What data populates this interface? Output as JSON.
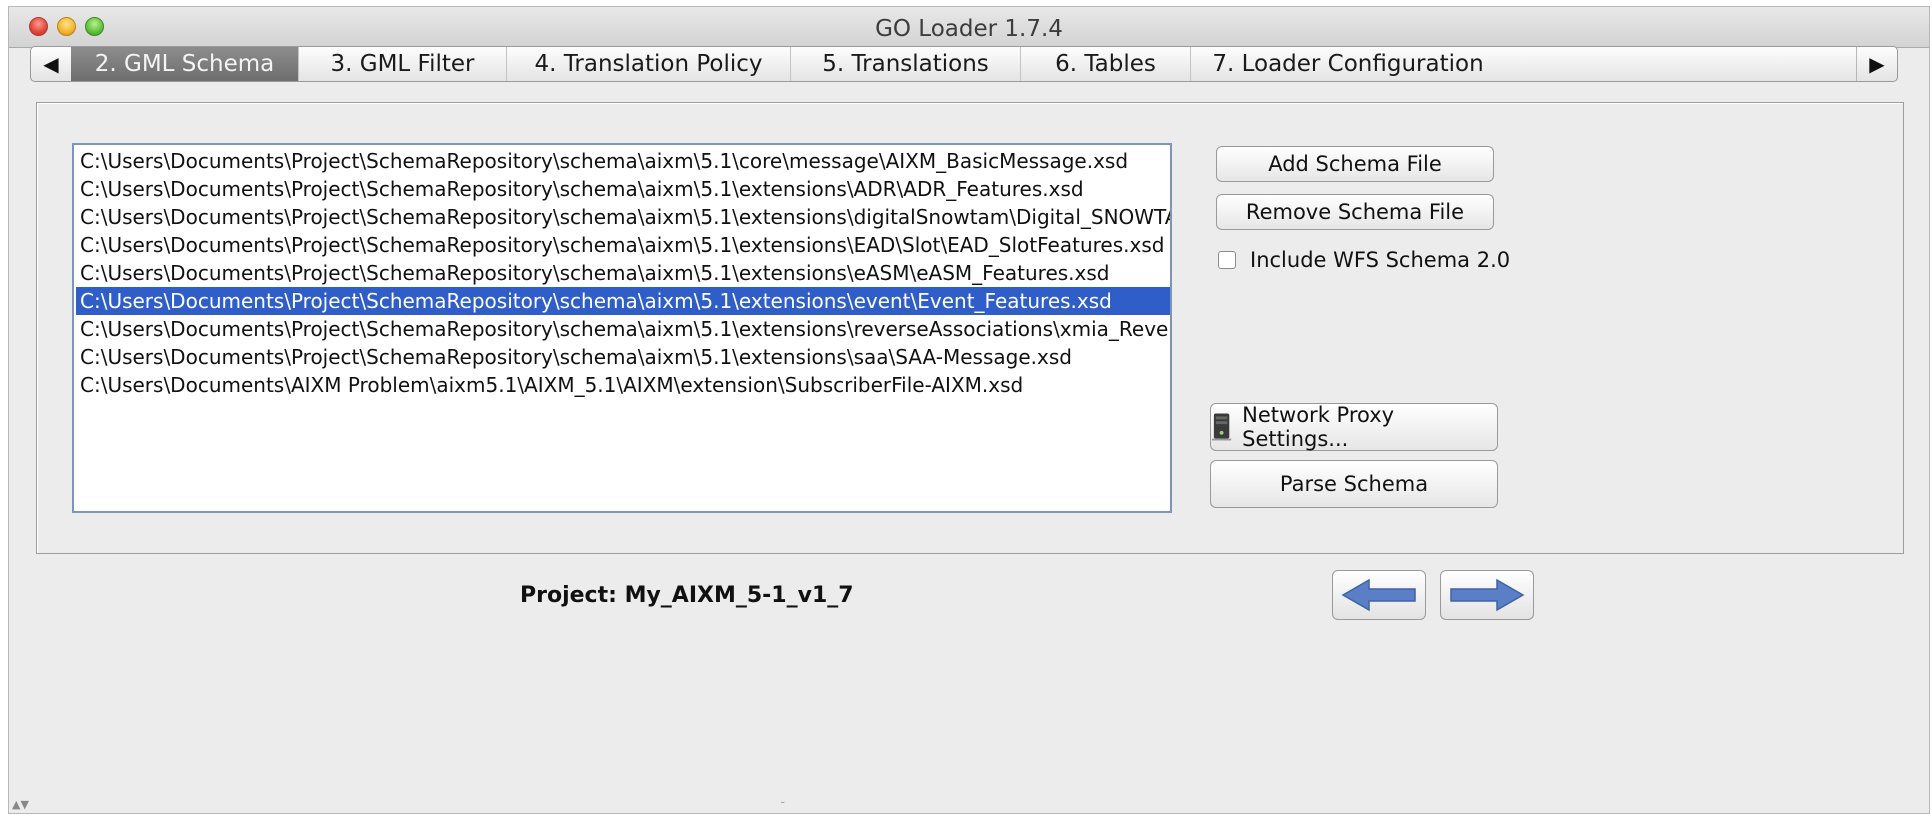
{
  "window": {
    "title": "GO Loader 1.7.4"
  },
  "tabs": {
    "items": [
      {
        "label": "2. GML Schema",
        "selected": true
      },
      {
        "label": "3. GML Filter",
        "selected": false
      },
      {
        "label": "4. Translation Policy",
        "selected": false
      },
      {
        "label": "5. Translations",
        "selected": false
      },
      {
        "label": "6. Tables",
        "selected": false
      },
      {
        "label": "7. Loader Configuration",
        "selected": false
      }
    ],
    "scroll_left_glyph": "◀",
    "scroll_right_glyph": "▶"
  },
  "schema_list": {
    "selected_index": 5,
    "items": [
      "C:\\Users\\Documents\\Project\\SchemaRepository\\schema\\aixm\\5.1\\core\\message\\AIXM_BasicMessage.xsd",
      "C:\\Users\\Documents\\Project\\SchemaRepository\\schema\\aixm\\5.1\\extensions\\ADR\\ADR_Features.xsd",
      "C:\\Users\\Documents\\Project\\SchemaRepository\\schema\\aixm\\5.1\\extensions\\digitalSnowtam\\Digital_SNOWTAM....",
      "C:\\Users\\Documents\\Project\\SchemaRepository\\schema\\aixm\\5.1\\extensions\\EAD\\Slot\\EAD_SlotFeatures.xsd",
      "C:\\Users\\Documents\\Project\\SchemaRepository\\schema\\aixm\\5.1\\extensions\\eASM\\eASM_Features.xsd",
      "C:\\Users\\Documents\\Project\\SchemaRepository\\schema\\aixm\\5.1\\extensions\\event\\Event_Features.xsd",
      "C:\\Users\\Documents\\Project\\SchemaRepository\\schema\\aixm\\5.1\\extensions\\reverseAssociations\\xmia_Reverse...",
      "C:\\Users\\Documents\\Project\\SchemaRepository\\schema\\aixm\\5.1\\extensions\\saa\\SAA-Message.xsd",
      "C:\\Users\\Documents\\AIXM Problem\\aixm5.1\\AIXM_5.1\\AIXM\\extension\\SubscriberFile-AIXM.xsd"
    ]
  },
  "actions": {
    "add_schema": "Add Schema File",
    "remove_schema": "Remove Schema File",
    "include_wfs": {
      "label": "Include WFS Schema 2.0",
      "checked": false
    },
    "network_proxy": "Network Proxy Settings...",
    "parse_schema": "Parse Schema"
  },
  "footer": {
    "project_label": "Project: My_AIXM_5-1_v1_7"
  },
  "colors": {
    "selection": "#2f5ec9",
    "nav_arrow": "#5a7fc6"
  },
  "icons": {
    "back": "arrow-left-icon",
    "forward": "arrow-right-icon",
    "proxy": "server-icon"
  }
}
